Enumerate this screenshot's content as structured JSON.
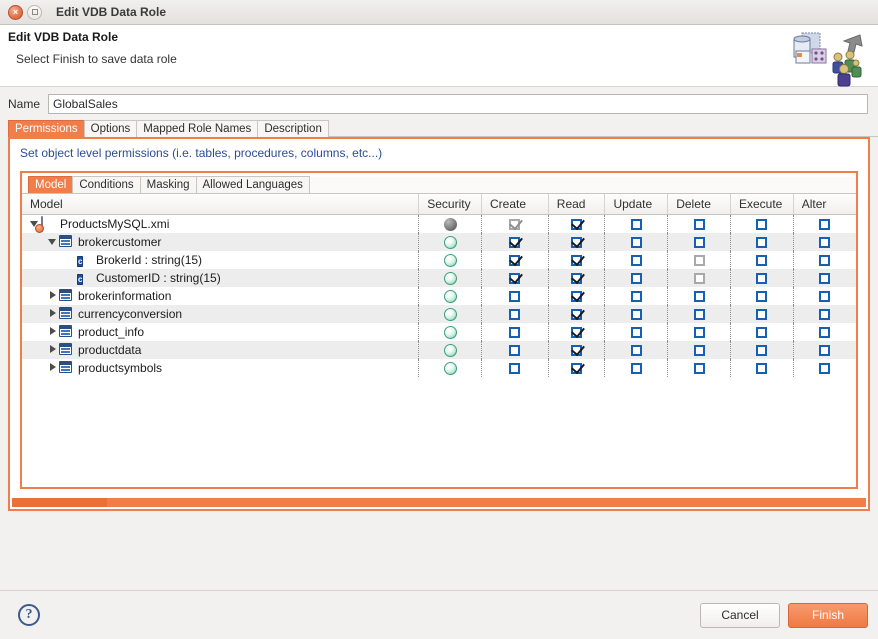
{
  "window": {
    "title": "Edit VDB Data Role",
    "close_label": "×",
    "maximize_label": ""
  },
  "banner": {
    "heading": "Edit VDB Data Role",
    "subheading": "Select Finish to save data role",
    "icon_name": "data-role-people-icon"
  },
  "name_field": {
    "label": "Name",
    "value": "GlobalSales",
    "placeholder": ""
  },
  "outer_tabs": [
    {
      "label": "Permissions",
      "active": true
    },
    {
      "label": "Options",
      "active": false
    },
    {
      "label": "Mapped Role Names",
      "active": false
    },
    {
      "label": "Description",
      "active": false
    }
  ],
  "permissions": {
    "description": "Set object level permissions (i.e. tables, procedures, columns, etc...)",
    "inner_tabs": [
      {
        "label": "Model",
        "active": true
      },
      {
        "label": "Conditions",
        "active": false
      },
      {
        "label": "Masking",
        "active": false
      },
      {
        "label": "Allowed Languages",
        "active": false
      }
    ],
    "columns": [
      "Model",
      "Security",
      "Create",
      "Read",
      "Update",
      "Delete",
      "Execute",
      "Alter"
    ],
    "rows": [
      {
        "label": "ProductsMySQL.xmi",
        "indent": 0,
        "twisty": "expanded",
        "icon": "model-xmi-icon",
        "security": "gray",
        "create": "checked-disabled",
        "read": "checked",
        "update": "unchecked",
        "delete": "unchecked",
        "execute": "unchecked",
        "alter": "unchecked"
      },
      {
        "label": "brokercustomer",
        "indent": 1,
        "twisty": "expanded",
        "icon": "table-icon",
        "security": "green",
        "create": "checked",
        "read": "checked",
        "update": "unchecked",
        "delete": "unchecked",
        "execute": "unchecked",
        "alter": "unchecked"
      },
      {
        "label": "BrokerId : string(15)",
        "indent": 2,
        "twisty": "none",
        "icon": "column-icon",
        "security": "green",
        "create": "checked",
        "read": "checked",
        "update": "unchecked",
        "delete": "unchecked-disabled",
        "execute": "unchecked",
        "alter": "unchecked"
      },
      {
        "label": "CustomerID : string(15)",
        "indent": 2,
        "twisty": "none",
        "icon": "column-icon",
        "security": "green",
        "create": "checked",
        "read": "checked",
        "update": "unchecked",
        "delete": "unchecked-disabled",
        "execute": "unchecked",
        "alter": "unchecked"
      },
      {
        "label": "brokerinformation",
        "indent": 1,
        "twisty": "collapsed",
        "icon": "table-icon",
        "security": "green",
        "create": "unchecked",
        "read": "checked",
        "update": "unchecked",
        "delete": "unchecked",
        "execute": "unchecked",
        "alter": "unchecked"
      },
      {
        "label": "currencyconversion",
        "indent": 1,
        "twisty": "collapsed",
        "icon": "table-icon",
        "security": "green",
        "create": "unchecked",
        "read": "checked",
        "update": "unchecked",
        "delete": "unchecked",
        "execute": "unchecked",
        "alter": "unchecked"
      },
      {
        "label": "product_info",
        "indent": 1,
        "twisty": "collapsed",
        "icon": "table-icon",
        "security": "green",
        "create": "unchecked",
        "read": "checked",
        "update": "unchecked",
        "delete": "unchecked",
        "execute": "unchecked",
        "alter": "unchecked"
      },
      {
        "label": "productdata",
        "indent": 1,
        "twisty": "collapsed",
        "icon": "table-icon",
        "security": "green",
        "create": "unchecked",
        "read": "checked",
        "update": "unchecked",
        "delete": "unchecked",
        "execute": "unchecked",
        "alter": "unchecked"
      },
      {
        "label": "productsymbols",
        "indent": 1,
        "twisty": "collapsed",
        "icon": "table-icon",
        "security": "green",
        "create": "unchecked",
        "read": "checked",
        "update": "unchecked",
        "delete": "unchecked",
        "execute": "unchecked",
        "alter": "unchecked"
      }
    ]
  },
  "footer": {
    "help_label": "?",
    "cancel_label": "Cancel",
    "finish_label": "Finish"
  },
  "colors": {
    "accent": "#f07d4a",
    "link": "#2b4b9b",
    "checkbox": "#1660b4",
    "security_green": "#46a884"
  }
}
